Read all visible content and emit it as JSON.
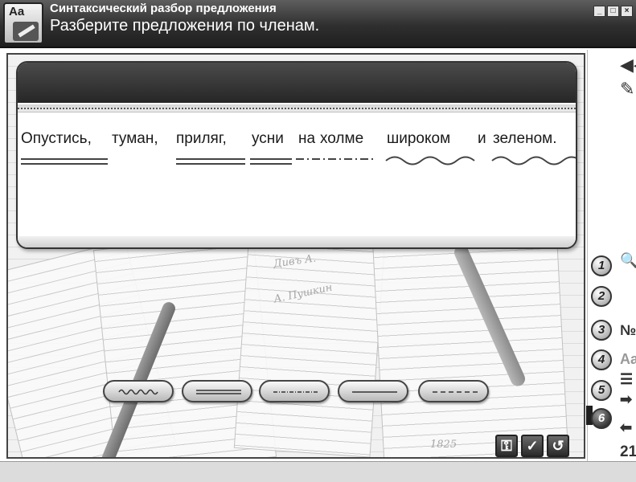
{
  "window": {
    "title": "Синтаксический разбор предложения",
    "subtitle": "Разберите предложения по членам.",
    "app_icon_text": "Aa",
    "controls": [
      "_",
      "□",
      "×"
    ]
  },
  "sentence": {
    "words": [
      "Опустись,",
      "туман,",
      "приляг,",
      "усни",
      "на",
      "холме",
      "широком",
      "и",
      "зеленом."
    ],
    "underlines": [
      {
        "word": "Опустись,",
        "type": "double-line",
        "meaning": "сказуемое"
      },
      {
        "word": "приляг,",
        "type": "double-line",
        "meaning": "сказуемое"
      },
      {
        "word": "усни",
        "type": "double-line",
        "meaning": "сказуемое"
      },
      {
        "word": "холме",
        "type": "dash-dot",
        "meaning": "обстоятельство"
      },
      {
        "word": "широком",
        "type": "wavy",
        "meaning": "определение"
      },
      {
        "word": "зеленом.",
        "type": "wavy",
        "meaning": "определение"
      }
    ]
  },
  "choices": [
    {
      "type": "wavy",
      "name": "определение"
    },
    {
      "type": "double-line",
      "name": "сказуемое"
    },
    {
      "type": "dash-dot",
      "name": "обстоятельство"
    },
    {
      "type": "single-line",
      "name": "подлежащее"
    },
    {
      "type": "dashed",
      "name": "дополнение"
    }
  ],
  "controls": {
    "hint_icon": "key-icon",
    "check_label": "✓",
    "reset_label": "↺"
  },
  "background_scribbles": [
    "Дивъ А.",
    "А. Пушкин",
    "1825"
  ],
  "sidebar": {
    "top_icons": [
      "rewind-icon",
      "pencil-icon"
    ],
    "steps": [
      {
        "number": "1",
        "glyph": "🔍",
        "glyph_name": "zoom-icon",
        "active": false
      },
      {
        "number": "2",
        "glyph": "",
        "glyph_name": "",
        "active": false
      },
      {
        "number": "3",
        "glyph": "№",
        "glyph_name": "number-icon",
        "active": false
      },
      {
        "number": "4",
        "glyph": "Aa",
        "glyph_name": "font-icon",
        "active": false
      },
      {
        "number": "5",
        "glyph": "☰",
        "glyph_name": "list-icon",
        "active": false
      },
      {
        "number": "6",
        "glyph": "➡",
        "glyph_name": "next-icon",
        "active": true
      }
    ],
    "back_glyph": "⬅",
    "page_number": "21"
  },
  "colors": {
    "titlebar": "#2f2f2f",
    "panel_header": "#333333",
    "underline": "#444444"
  }
}
